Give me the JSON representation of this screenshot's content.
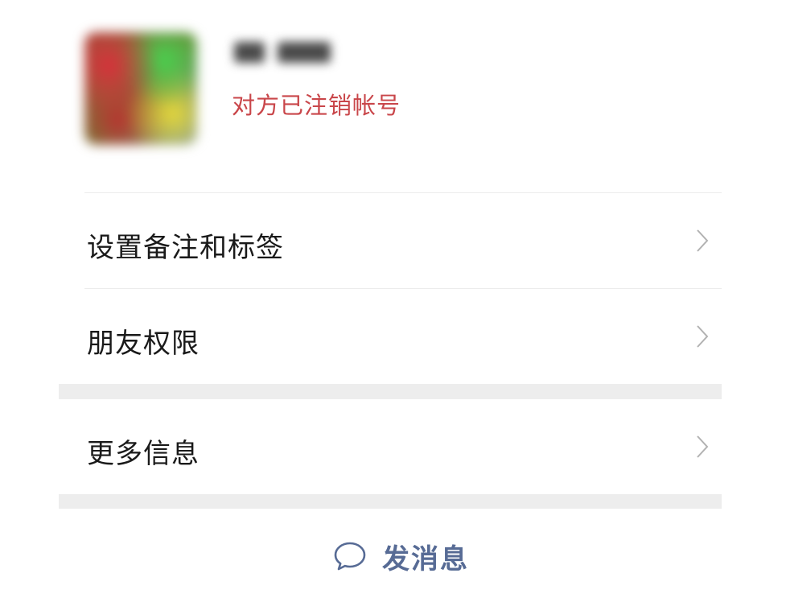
{
  "profile": {
    "status": "对方已注销帐号"
  },
  "menu": {
    "items": [
      {
        "label": "设置备注和标签"
      },
      {
        "label": "朋友权限"
      },
      {
        "label": "更多信息"
      }
    ]
  },
  "actions": {
    "send_message_label": "发消息"
  },
  "icons": {
    "chevron": "chevron-right-icon",
    "message": "chat-bubble-icon"
  },
  "colors": {
    "status_red": "#c9464a",
    "link_blue": "#576b95",
    "separator": "#ededed"
  }
}
